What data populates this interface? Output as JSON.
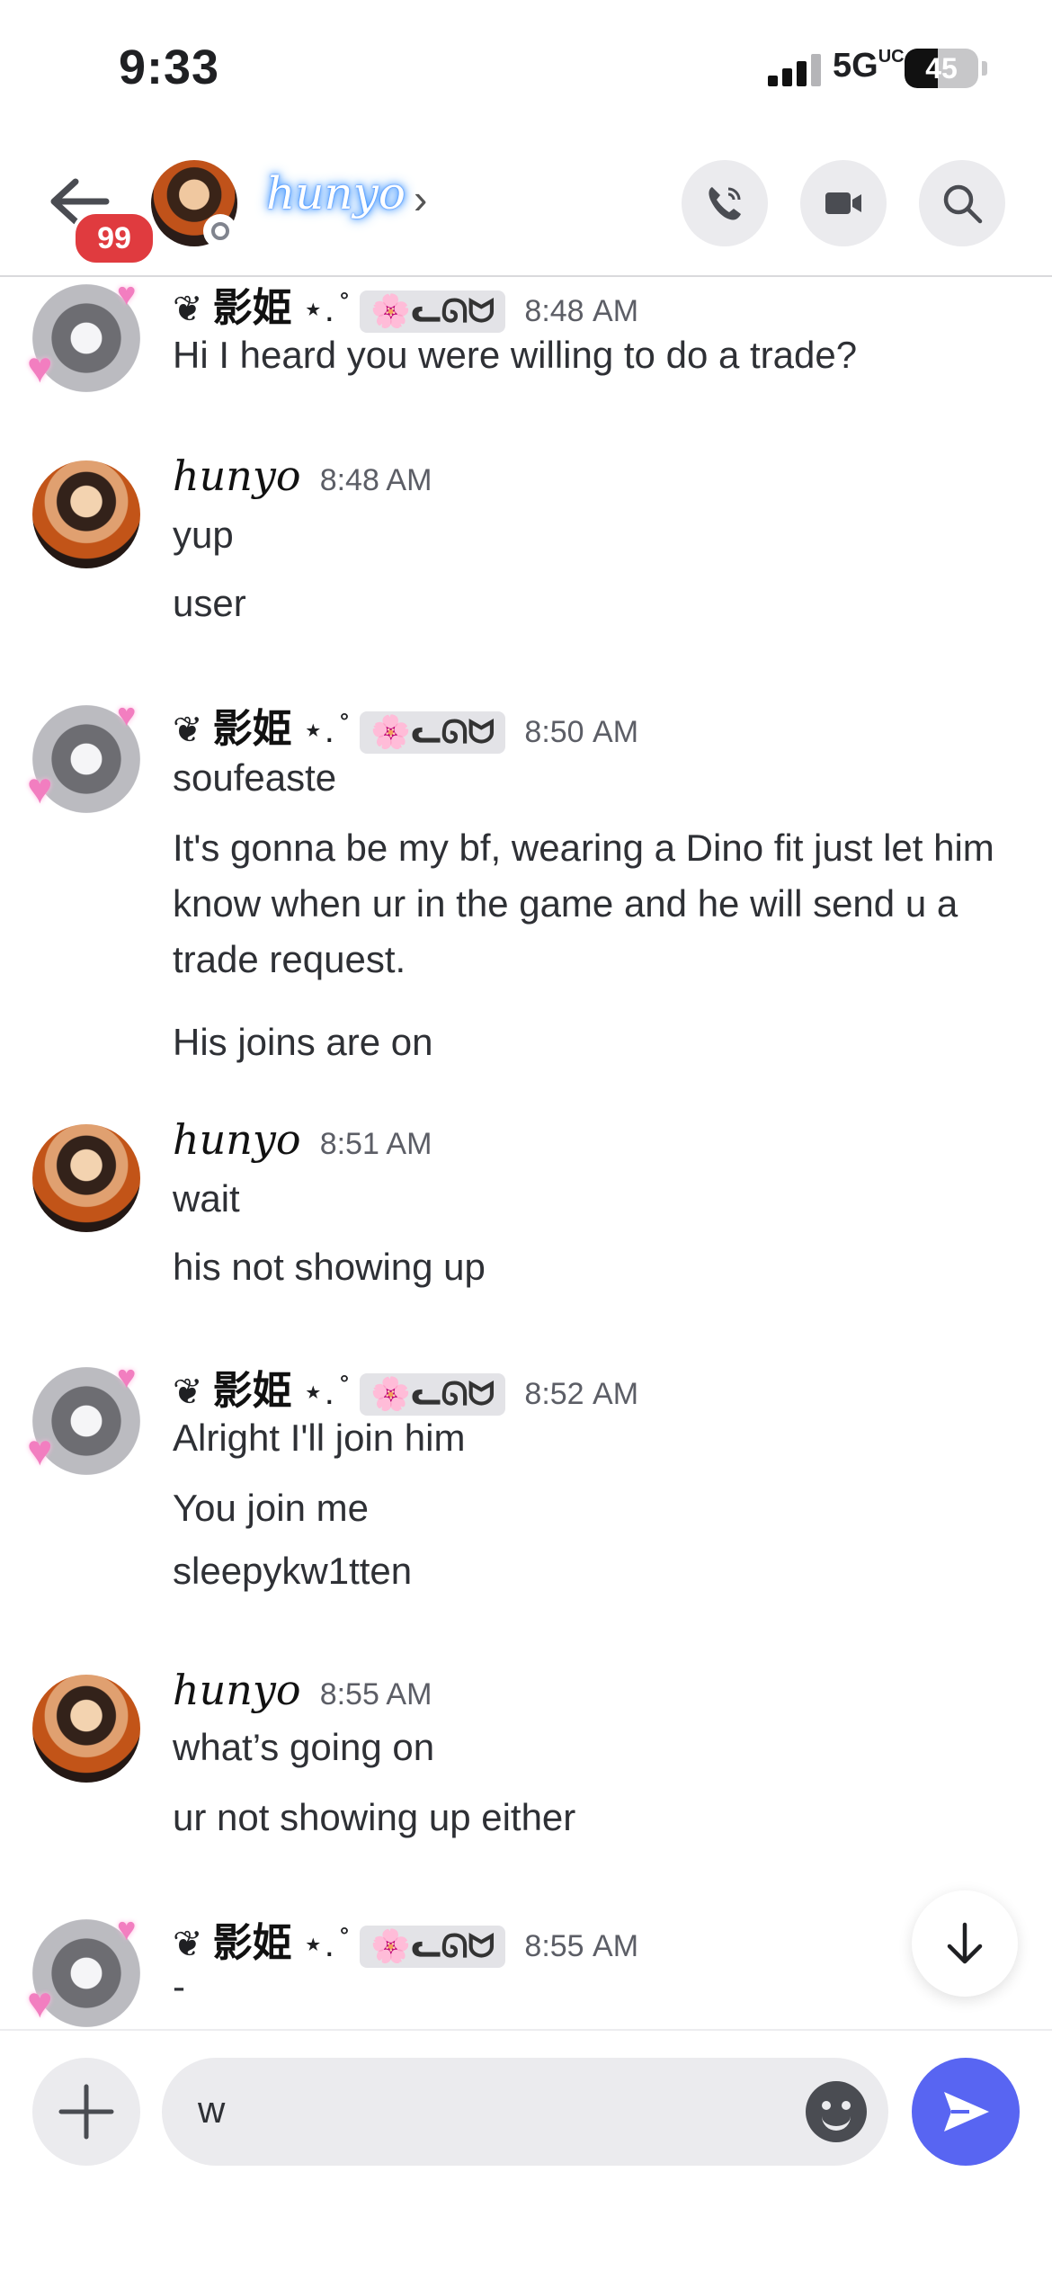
{
  "status_bar": {
    "time": "9:33",
    "network": "5G",
    "network_suffix": "UC",
    "battery": "45",
    "battery_level": 0.45
  },
  "header": {
    "unread_badge": "99",
    "channel_name": "hunyo",
    "icons": [
      "back-arrow-icon",
      "phone-icon",
      "video-camera-icon",
      "search-icon"
    ]
  },
  "users": {
    "girl": {
      "name_prefix": "❦",
      "name": "影姫",
      "name_suffix": "⋆. ̊",
      "tag_icon": "🌸",
      "tag": "ᓚᘏᗢ"
    },
    "hunyo": {
      "name": "hunyo"
    }
  },
  "messages": [
    {
      "user": "girl",
      "time": "8:48 AM",
      "lines": [
        "Hi I heard you were willing to do a trade?"
      ]
    },
    {
      "user": "hunyo",
      "time": "8:48 AM",
      "lines": [
        "yup",
        "user"
      ]
    },
    {
      "user": "girl",
      "time": "8:50 AM",
      "lines": [
        "soufeaste",
        "It's gonna be my bf, wearing a Dino fit just let him know when ur in the game and he will send u a trade request.",
        "His joins are on"
      ]
    },
    {
      "user": "hunyo",
      "time": "8:51 AM",
      "lines": [
        "wait",
        "his not showing up"
      ]
    },
    {
      "user": "girl",
      "time": "8:52 AM",
      "lines": [
        "Alright I'll join him",
        "You join me",
        "sleepykw1tten"
      ]
    },
    {
      "user": "hunyo",
      "time": "8:55 AM",
      "lines": [
        "what’s going on",
        "ur not showing up either"
      ]
    },
    {
      "user": "girl",
      "time": "8:55 AM",
      "lines": [
        "-"
      ]
    }
  ],
  "composer": {
    "input_value": "w"
  }
}
